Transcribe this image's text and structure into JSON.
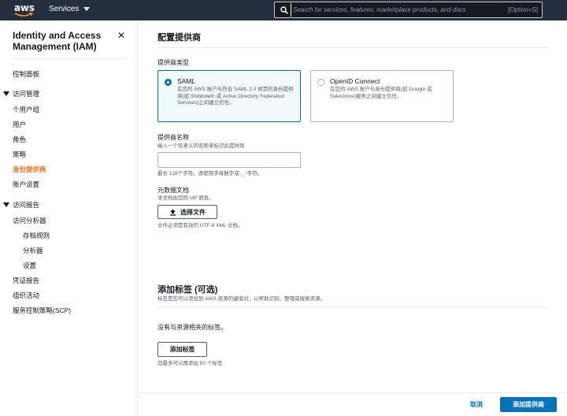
{
  "topbar": {
    "logo_text": "aws",
    "services_label": "Services",
    "search_placeholder": "Search for services, features, marketplace products, and docs",
    "search_shortcut": "[Option+S]"
  },
  "sidebar": {
    "title": "Identity and Access Management (IAM)",
    "close_glyph": "✕",
    "dashboard": "控制面板",
    "access_mgmt": {
      "label": "访问管理",
      "items": [
        "个用户组",
        "用户",
        "角色",
        "策略",
        "身份提供商",
        "账户设置"
      ],
      "active_index": 4
    },
    "access_reports": {
      "label": "访问报告",
      "analyzer": "访问分析器",
      "analyzer_items": [
        "存档规则",
        "分析器",
        "设置"
      ],
      "items": [
        "凭证报告",
        "组织活动",
        "服务控制策略(SCP)"
      ]
    }
  },
  "main": {
    "title": "配置提供商",
    "provider_type_label": "提供商类型",
    "saml": {
      "name": "SAML",
      "desc": "在您的 AWS 账户与符合 SAML 2.0 规范的身份提供商(如 Shibboleth 或 Active Directory Federation Services)之间建立信任。",
      "selected": true
    },
    "oidc": {
      "name": "OpenID Connect",
      "desc": "在您的 AWS 账户与身份提供商(如 Google 或 Salesforce)服务之间建立信任。",
      "selected": false
    },
    "provider_name": {
      "label": "提供商名称",
      "desc": "输入一个有意义的名称来标识此提供商",
      "value": "",
      "hint": "最长 128个字符。请使用字母数字或'._-'字符。"
    },
    "metadata": {
      "label": "元数据文档",
      "desc": "本文档由您的 IdP 颁发。",
      "button": "选择文件",
      "hint": "文件必须是有效的 UTF-8 XML 文档。"
    },
    "tags": {
      "title": "添加标签 (可选)",
      "desc": "标签是您可以添加到 AWS 资源的键值对，以帮助识别、整理或搜索资源。",
      "empty": "没有与资源相关的标签。",
      "button": "添加标签",
      "hint": "您最多可以再添加 50 个标签"
    },
    "footer": {
      "cancel": "取消",
      "submit": "添加提供商"
    }
  },
  "colors": {
    "topbar_bg": "#232f3e",
    "accent_orange": "#ec7211",
    "primary_blue": "#0073bb"
  }
}
